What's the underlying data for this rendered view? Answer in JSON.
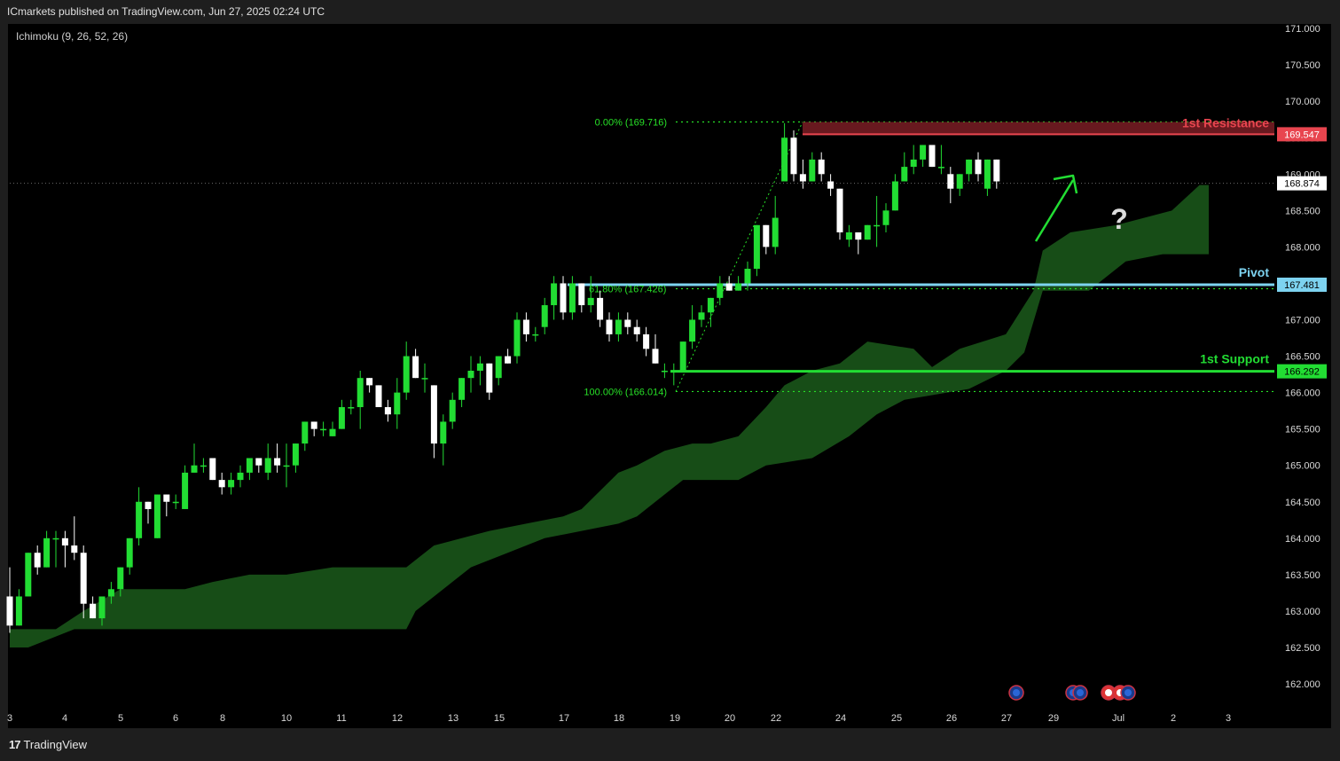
{
  "header": {
    "published": "ICmarkets published on TradingView.com, Jun 27, 2025 02:24 UTC"
  },
  "indicator": {
    "label": "Ichimoku (9, 26, 52, 26)"
  },
  "footer": {
    "brand": "TradingView",
    "logo": "17"
  },
  "colors": {
    "bull": "#22dd33",
    "bear": "#ffffff",
    "cloud": "#174d17",
    "resistance": "#e8454f",
    "pivot": "#7dd3f0",
    "support": "#22dd33",
    "fib": "#27e027"
  },
  "chart_data": {
    "type": "candlestick",
    "y_axis": {
      "min": 162.0,
      "max": 171.0,
      "ticks": [
        "171.000",
        "170.500",
        "170.000",
        "169.500",
        "169.000",
        "168.500",
        "168.000",
        "167.500",
        "167.000",
        "166.500",
        "166.000",
        "165.500",
        "165.000",
        "164.500",
        "164.000",
        "163.500",
        "163.000",
        "162.500",
        "162.000"
      ]
    },
    "x_axis": {
      "ticks": [
        "3",
        "4",
        "5",
        "6",
        "8",
        "10",
        "11",
        "12",
        "13",
        "15",
        "17",
        "18",
        "19",
        "20",
        "22",
        "24",
        "25",
        "26",
        "27",
        "29",
        "Jul",
        "2",
        "3"
      ]
    },
    "candles": [
      [
        163.2,
        163.6,
        162.7,
        162.8
      ],
      [
        162.8,
        163.3,
        162.8,
        163.2
      ],
      [
        163.2,
        163.8,
        163.2,
        163.8
      ],
      [
        163.8,
        163.9,
        163.5,
        163.6
      ],
      [
        163.6,
        164.1,
        163.6,
        164.0
      ],
      [
        164.0,
        164.1,
        163.6,
        164.0
      ],
      [
        164.0,
        164.1,
        163.6,
        163.9
      ],
      [
        163.9,
        164.3,
        163.7,
        163.8
      ],
      [
        163.8,
        163.9,
        162.9,
        163.1
      ],
      [
        163.1,
        163.2,
        162.9,
        162.9
      ],
      [
        162.9,
        163.2,
        162.8,
        163.2
      ],
      [
        163.2,
        163.4,
        163.1,
        163.3
      ],
      [
        163.3,
        163.6,
        163.2,
        163.6
      ],
      [
        163.6,
        164.0,
        163.5,
        164.0
      ],
      [
        164.0,
        164.7,
        163.9,
        164.5
      ],
      [
        164.5,
        164.5,
        164.2,
        164.4
      ],
      [
        164.0,
        164.6,
        164.0,
        164.6
      ],
      [
        164.6,
        164.6,
        164.3,
        164.5
      ],
      [
        164.5,
        164.6,
        164.4,
        164.5
      ],
      [
        164.4,
        165.0,
        164.4,
        164.9
      ],
      [
        164.9,
        165.3,
        164.9,
        165.0
      ],
      [
        165.0,
        165.1,
        164.9,
        165.0
      ],
      [
        165.1,
        165.1,
        164.8,
        164.8
      ],
      [
        164.8,
        164.9,
        164.6,
        164.7
      ],
      [
        164.7,
        164.9,
        164.6,
        164.8
      ],
      [
        164.8,
        165.0,
        164.7,
        164.9
      ],
      [
        164.9,
        165.1,
        164.8,
        165.1
      ],
      [
        165.1,
        165.1,
        164.9,
        165.0
      ],
      [
        164.9,
        165.3,
        164.8,
        165.1
      ],
      [
        165.1,
        165.3,
        164.9,
        165.0
      ],
      [
        165.0,
        165.3,
        164.7,
        165.0
      ],
      [
        165.0,
        165.3,
        164.9,
        165.3
      ],
      [
        165.3,
        165.6,
        165.2,
        165.6
      ],
      [
        165.6,
        165.6,
        165.4,
        165.5
      ],
      [
        165.5,
        165.6,
        165.4,
        165.5
      ],
      [
        165.4,
        165.6,
        165.4,
        165.5
      ],
      [
        165.5,
        165.9,
        165.5,
        165.8
      ],
      [
        165.8,
        165.9,
        165.7,
        165.8
      ],
      [
        165.8,
        166.3,
        165.5,
        166.2
      ],
      [
        166.2,
        166.2,
        166.0,
        166.1
      ],
      [
        166.1,
        166.1,
        165.8,
        165.8
      ],
      [
        165.8,
        165.9,
        165.6,
        165.7
      ],
      [
        165.7,
        166.2,
        165.5,
        166.0
      ],
      [
        166.0,
        166.7,
        165.9,
        166.5
      ],
      [
        166.5,
        166.6,
        166.2,
        166.2
      ],
      [
        166.2,
        166.4,
        166.0,
        166.2
      ],
      [
        166.1,
        166.1,
        165.1,
        165.3
      ],
      [
        165.3,
        165.7,
        165.0,
        165.6
      ],
      [
        165.6,
        166.0,
        165.5,
        165.9
      ],
      [
        165.9,
        166.2,
        165.8,
        166.2
      ],
      [
        166.2,
        166.5,
        166.0,
        166.3
      ],
      [
        166.3,
        166.5,
        166.1,
        166.4
      ],
      [
        166.4,
        166.4,
        165.9,
        166.0
      ],
      [
        166.2,
        166.5,
        166.1,
        166.5
      ],
      [
        166.5,
        166.6,
        166.4,
        166.4
      ],
      [
        166.5,
        167.1,
        166.4,
        167.0
      ],
      [
        167.0,
        167.1,
        166.7,
        166.8
      ],
      [
        166.8,
        166.9,
        166.7,
        166.8
      ],
      [
        166.9,
        167.3,
        166.8,
        167.2
      ],
      [
        167.2,
        167.6,
        167.0,
        167.5
      ],
      [
        167.5,
        167.6,
        167.0,
        167.1
      ],
      [
        167.1,
        167.6,
        167.0,
        167.5
      ],
      [
        167.5,
        167.5,
        167.1,
        167.2
      ],
      [
        167.2,
        167.6,
        167.1,
        167.3
      ],
      [
        167.3,
        167.4,
        166.9,
        167.0
      ],
      [
        167.0,
        167.1,
        166.7,
        166.8
      ],
      [
        166.8,
        167.1,
        166.7,
        167.0
      ],
      [
        167.0,
        167.1,
        166.8,
        166.9
      ],
      [
        166.9,
        167.0,
        166.7,
        166.8
      ],
      [
        166.8,
        166.9,
        166.5,
        166.6
      ],
      [
        166.6,
        166.8,
        166.4,
        166.4
      ],
      [
        166.3,
        166.4,
        166.2,
        166.3
      ],
      [
        166.3,
        166.4,
        166.1,
        166.3
      ],
      [
        166.3,
        166.7,
        166.3,
        166.7
      ],
      [
        166.7,
        167.2,
        166.6,
        167.0
      ],
      [
        167.0,
        167.2,
        166.9,
        167.1
      ],
      [
        167.1,
        167.3,
        166.9,
        167.3
      ],
      [
        167.3,
        167.6,
        167.2,
        167.5
      ],
      [
        167.5,
        167.6,
        167.4,
        167.4
      ],
      [
        167.4,
        167.6,
        167.4,
        167.5
      ],
      [
        167.5,
        167.8,
        167.4,
        167.7
      ],
      [
        167.7,
        168.3,
        167.6,
        168.3
      ],
      [
        168.3,
        168.3,
        167.9,
        168.0
      ],
      [
        168.0,
        168.7,
        167.9,
        168.4
      ],
      [
        168.9,
        169.7,
        168.9,
        169.5
      ],
      [
        169.5,
        169.6,
        168.9,
        169.0
      ],
      [
        169.0,
        169.2,
        168.8,
        168.9
      ],
      [
        168.9,
        169.3,
        168.9,
        169.2
      ],
      [
        169.2,
        169.3,
        168.9,
        169.0
      ],
      [
        168.9,
        169.0,
        168.7,
        168.8
      ],
      [
        168.8,
        168.8,
        168.1,
        168.2
      ],
      [
        168.1,
        168.3,
        168.0,
        168.2
      ],
      [
        168.2,
        168.2,
        167.9,
        168.1
      ],
      [
        168.1,
        168.3,
        168.1,
        168.3
      ],
      [
        168.3,
        168.7,
        168.0,
        168.3
      ],
      [
        168.3,
        168.6,
        168.2,
        168.5
      ],
      [
        168.5,
        169.0,
        168.5,
        168.9
      ],
      [
        168.9,
        169.3,
        168.9,
        169.1
      ],
      [
        169.1,
        169.4,
        169.0,
        169.2
      ],
      [
        169.2,
        169.4,
        169.1,
        169.4
      ],
      [
        169.4,
        169.4,
        169.1,
        169.1
      ],
      [
        169.1,
        169.4,
        169.0,
        169.1
      ],
      [
        169.0,
        169.1,
        168.6,
        168.8
      ],
      [
        168.8,
        169.0,
        168.7,
        169.0
      ],
      [
        169.0,
        169.2,
        168.9,
        169.2
      ],
      [
        169.2,
        169.3,
        168.9,
        169.0
      ],
      [
        168.8,
        169.2,
        168.7,
        169.2
      ],
      [
        169.2,
        169.2,
        168.8,
        168.9
      ]
    ],
    "ichimoku_cloud": {
      "upper": [
        [
          0,
          162.75
        ],
        [
          5,
          162.75
        ],
        [
          8,
          163.0
        ],
        [
          12,
          163.3
        ],
        [
          19,
          163.3
        ],
        [
          22,
          163.4
        ],
        [
          26,
          163.5
        ],
        [
          30,
          163.5
        ],
        [
          35,
          163.6
        ],
        [
          43,
          163.6
        ],
        [
          46,
          163.9
        ],
        [
          49,
          164.0
        ],
        [
          52,
          164.1
        ],
        [
          56,
          164.2
        ],
        [
          60,
          164.3
        ],
        [
          62,
          164.4
        ],
        [
          66,
          164.9
        ],
        [
          68,
          165.0
        ],
        [
          71,
          165.2
        ],
        [
          74,
          165.3
        ],
        [
          76,
          165.3
        ],
        [
          79,
          165.4
        ],
        [
          82,
          165.8
        ],
        [
          84,
          166.1
        ],
        [
          87,
          166.3
        ],
        [
          90,
          166.4
        ],
        [
          93,
          166.7
        ],
        [
          98,
          166.6
        ],
        [
          100,
          166.35
        ],
        [
          103,
          166.6
        ],
        [
          108,
          166.8
        ],
        [
          111,
          167.4
        ],
        [
          112,
          167.95
        ],
        [
          115,
          168.2
        ],
        [
          120,
          168.3
        ],
        [
          126,
          168.5
        ],
        [
          129,
          168.85
        ],
        [
          130,
          168.85
        ]
      ],
      "lower": [
        [
          130,
          167.9
        ],
        [
          125,
          167.9
        ],
        [
          121,
          167.8
        ],
        [
          117,
          167.4
        ],
        [
          113,
          167.4
        ],
        [
          112,
          167.4
        ],
        [
          110,
          166.55
        ],
        [
          108,
          166.3
        ],
        [
          104,
          166.05
        ],
        [
          97,
          165.9
        ],
        [
          94,
          165.7
        ],
        [
          91,
          165.4
        ],
        [
          87,
          165.1
        ],
        [
          82,
          165.0
        ],
        [
          79,
          164.8
        ],
        [
          73,
          164.8
        ],
        [
          70,
          164.5
        ],
        [
          68,
          164.3
        ],
        [
          66,
          164.2
        ],
        [
          62,
          164.1
        ],
        [
          58,
          164.0
        ],
        [
          54,
          163.8
        ],
        [
          50,
          163.6
        ],
        [
          46,
          163.2
        ],
        [
          44,
          163.0
        ],
        [
          43,
          162.75
        ],
        [
          36,
          162.75
        ],
        [
          25,
          162.75
        ],
        [
          7,
          162.75
        ],
        [
          2,
          162.5
        ],
        [
          0,
          162.5
        ]
      ]
    },
    "levels": {
      "resistance": {
        "label": "1st Resistance",
        "value": "169.547",
        "y": 169.547
      },
      "pivot": {
        "label": "Pivot",
        "value": "167.481",
        "y": 167.481
      },
      "support": {
        "label": "1st Support",
        "value": "166.292",
        "y": 166.292
      },
      "current": {
        "value": "168.874",
        "y": 168.874
      },
      "fib_top": {
        "label": "0.00% (169.716)",
        "y": 169.716
      },
      "fib_mid": {
        "label": "61.80% (167.426)",
        "y": 167.426
      },
      "fib_bottom": {
        "label": "100.00% (166.014)",
        "y": 166.014
      }
    },
    "annotation": {
      "question": "?"
    }
  }
}
